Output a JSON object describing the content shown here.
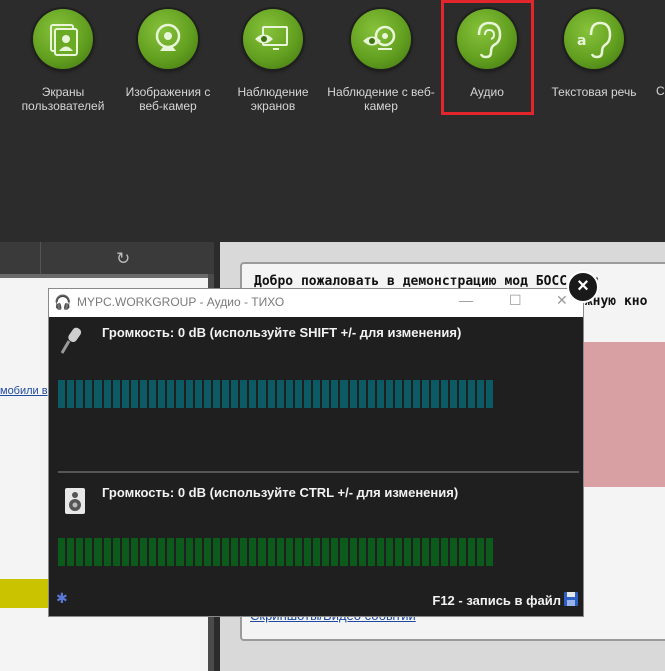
{
  "toolbar": {
    "items": [
      {
        "label": "Экраны пользователей",
        "icon": "user-screens-icon"
      },
      {
        "label": "Изображения с веб-камер",
        "icon": "webcam-icon"
      },
      {
        "label": "Наблюдение экранов",
        "icon": "eye-monitor-icon"
      },
      {
        "label": "Наблюдение с веб-камер",
        "icon": "eye-webcam-icon"
      },
      {
        "label": "Аудио",
        "icon": "ear-icon"
      },
      {
        "label": "Текстовая речь",
        "icon": "ear-text-icon"
      }
    ],
    "edge_right_label": "С",
    "selected_color": "#e3262b",
    "accent_color": "#63a020"
  },
  "left_panel": {
    "link_text": "мобили в"
  },
  "right_panel": {
    "welcome_line1": "Добро пожаловать в демонстрацию мод",
    "welcome_line1_end": "БОСС-Онл",
    "welcome_line2_end": "ужную кно",
    "bottom_link": "Скриншоты/Видео событий"
  },
  "dialog": {
    "title": "MYPC.WORKGROUP - Аудио - ТИХО",
    "mic_volume_label": "Громкость: 0 dB (используйте SHIFT +/- для изменения)",
    "speaker_volume_label": "Громкость: 0 dB (используйте CTRL +/- для изменения)",
    "record_label": "F12 - запись в файл",
    "mic_level": 0.0,
    "speaker_level": 0.0,
    "mic_meter_color": "#0b5a64",
    "speaker_meter_color": "#0d5a1d"
  }
}
